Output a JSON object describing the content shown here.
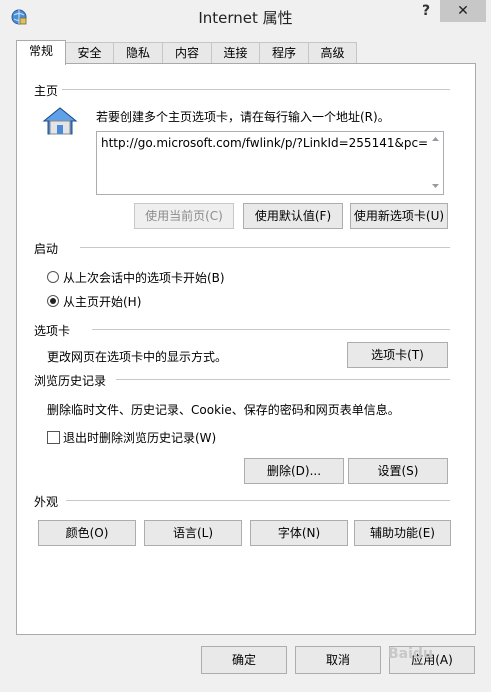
{
  "window": {
    "title": "Internet 属性",
    "help": "?",
    "close": "✕"
  },
  "tabs": [
    "常规",
    "安全",
    "隐私",
    "内容",
    "连接",
    "程序",
    "高级"
  ],
  "homepage": {
    "section_label": "主页",
    "instruction": "若要创建多个主页选项卡，请在每行输入一个地址(R)。",
    "url_value": "http://go.microsoft.com/fwlink/p/?LinkId=255141&pc=",
    "use_current": "使用当前页(C)",
    "use_default": "使用默认值(F)",
    "use_new_tab": "使用新选项卡(U)"
  },
  "startup": {
    "section_label": "启动",
    "option1": "从上次会话中的选项卡开始(B)",
    "option2": "从主页开始(H)",
    "selected": "option2"
  },
  "tabs_section": {
    "section_label": "选项卡",
    "description": "更改网页在选项卡中的显示方式。",
    "button": "选项卡(T)"
  },
  "history": {
    "section_label": "浏览历史记录",
    "description": "删除临时文件、历史记录、Cookie、保存的密码和网页表单信息。",
    "checkbox_label": "退出时删除浏览历史记录(W)",
    "checked": false,
    "delete_button": "删除(D)...",
    "settings_button": "设置(S)"
  },
  "appearance": {
    "section_label": "外观",
    "colors": "颜色(O)",
    "languages": "语言(L)",
    "fonts": "字体(N)",
    "accessibility": "辅助功能(E)"
  },
  "footer": {
    "ok": "确定",
    "cancel": "取消",
    "apply": "应用(A)"
  },
  "watermark": "Baidu"
}
